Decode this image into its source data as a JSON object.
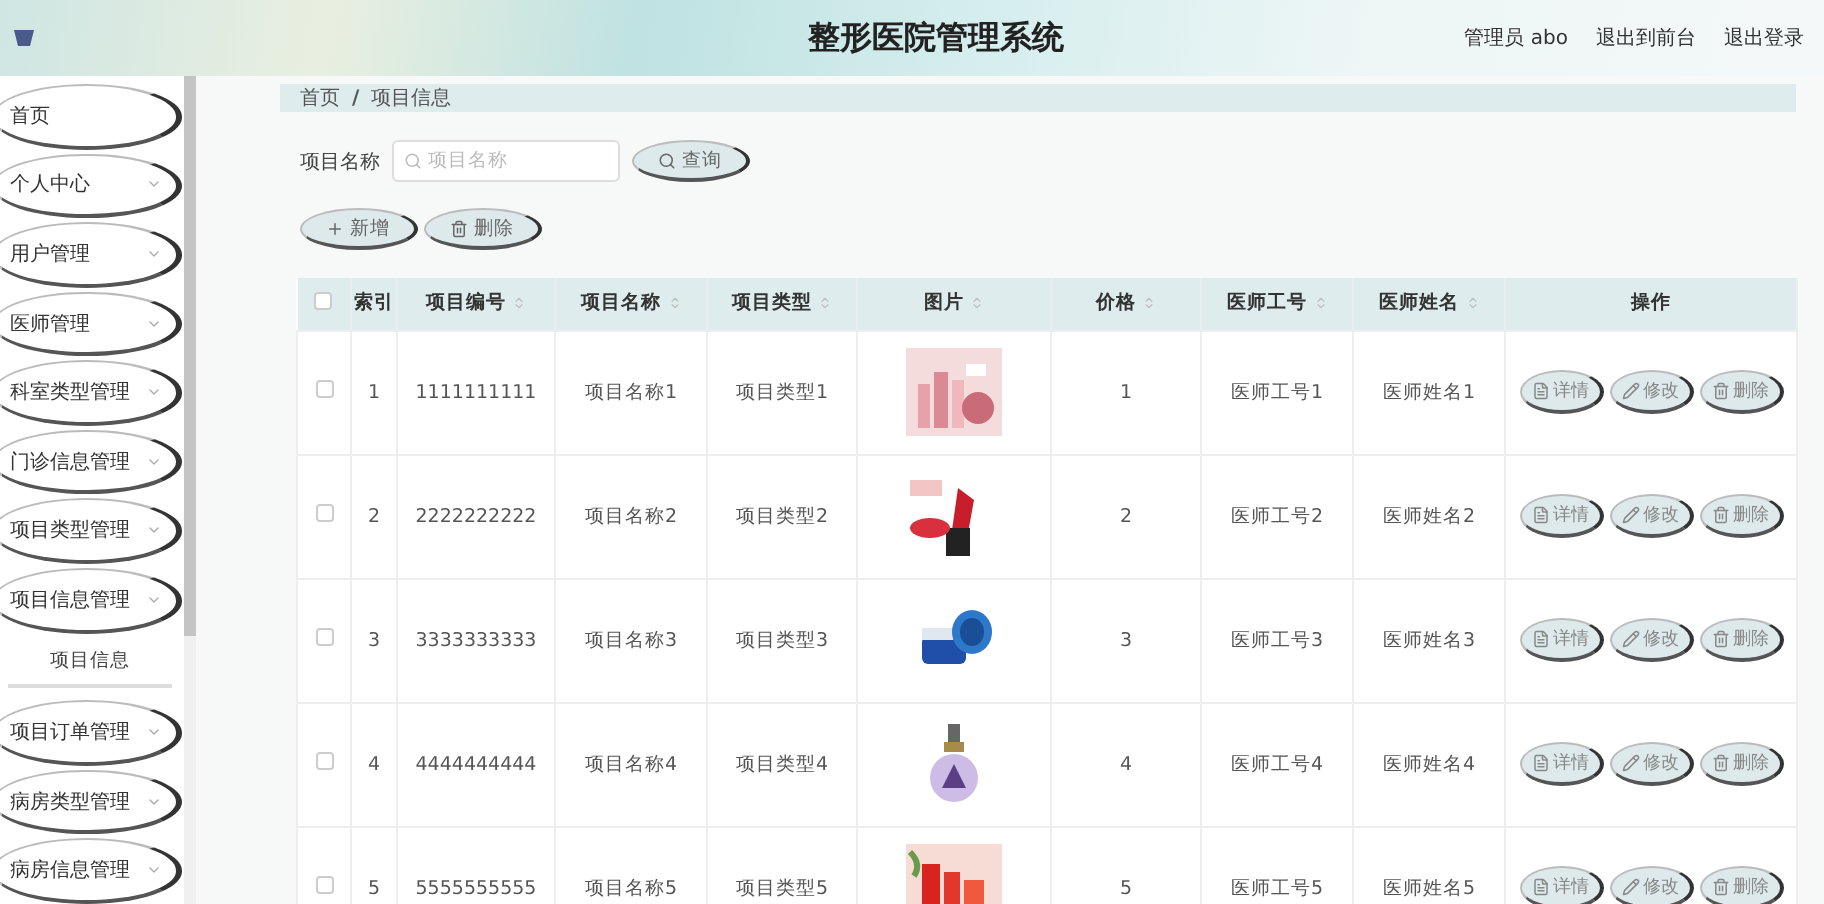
{
  "header": {
    "title": "整形医院管理系统",
    "user": "管理员 abo",
    "links": [
      "退出到前台",
      "退出登录"
    ]
  },
  "sidebar": {
    "items": [
      {
        "label": "首页",
        "has_caret": false
      },
      {
        "label": "个人中心",
        "has_caret": true
      },
      {
        "label": "用户管理",
        "has_caret": true
      },
      {
        "label": "医师管理",
        "has_caret": true
      },
      {
        "label": "科室类型管理",
        "has_caret": true
      },
      {
        "label": "门诊信息管理",
        "has_caret": true
      },
      {
        "label": "项目类型管理",
        "has_caret": true
      },
      {
        "label": "项目信息管理",
        "has_caret": true,
        "children": [
          {
            "label": "项目信息"
          }
        ]
      },
      {
        "label": "项目订单管理",
        "has_caret": true
      },
      {
        "label": "病房类型管理",
        "has_caret": true
      },
      {
        "label": "病房信息管理",
        "has_caret": true
      }
    ]
  },
  "breadcrumb": {
    "items": [
      "首页",
      "项目信息"
    ],
    "separator": "/"
  },
  "search": {
    "label": "项目名称",
    "placeholder": "项目名称",
    "button": "查询"
  },
  "actions": [
    {
      "kind": "add",
      "label": "新增"
    },
    {
      "kind": "delete",
      "label": "删除"
    }
  ],
  "table": {
    "header_checked": false,
    "columns": [
      {
        "label": "索引",
        "kind": "text",
        "sortable": false
      },
      {
        "label": "项目编号",
        "kind": "text",
        "sortable": true
      },
      {
        "label": "项目名称",
        "kind": "text",
        "sortable": true
      },
      {
        "label": "项目类型",
        "kind": "text",
        "sortable": true
      },
      {
        "label": "图片",
        "kind": "picture",
        "sortable": true
      },
      {
        "label": "价格",
        "kind": "text",
        "sortable": true
      },
      {
        "label": "医师工号",
        "kind": "text",
        "sortable": true
      },
      {
        "label": "医师姓名",
        "kind": "text",
        "sortable": true
      },
      {
        "label": "操作",
        "kind": "actions",
        "sortable": false
      }
    ],
    "rows": [
      {
        "checked": false,
        "cells": [
          "1",
          "1111111111",
          "项目名称1",
          "项目类型1",
          "",
          "1",
          "医师工号1",
          "医师姓名1"
        ],
        "actions": [
          {
            "kind": "detail",
            "label": "详情"
          },
          {
            "kind": "edit",
            "label": "修改"
          },
          {
            "kind": "delete",
            "label": "删除"
          }
        ]
      },
      {
        "checked": false,
        "cells": [
          "2",
          "2222222222",
          "项目名称2",
          "项目类型2",
          "",
          "2",
          "医师工号2",
          "医师姓名2"
        ],
        "actions": [
          {
            "kind": "detail",
            "label": "详情"
          },
          {
            "kind": "edit",
            "label": "修改"
          },
          {
            "kind": "delete",
            "label": "删除"
          }
        ]
      },
      {
        "checked": false,
        "cells": [
          "3",
          "3333333333",
          "项目名称3",
          "项目类型3",
          "",
          "3",
          "医师工号3",
          "医师姓名3"
        ],
        "actions": [
          {
            "kind": "detail",
            "label": "详情"
          },
          {
            "kind": "edit",
            "label": "修改"
          },
          {
            "kind": "delete",
            "label": "删除"
          }
        ]
      },
      {
        "checked": false,
        "cells": [
          "4",
          "4444444444",
          "项目名称4",
          "项目类型4",
          "",
          "4",
          "医师工号4",
          "医师姓名4"
        ],
        "actions": [
          {
            "kind": "detail",
            "label": "详情"
          },
          {
            "kind": "edit",
            "label": "修改"
          },
          {
            "kind": "delete",
            "label": "删除"
          }
        ]
      },
      {
        "checked": false,
        "cells": [
          "5",
          "5555555555",
          "项目名称5",
          "项目类型5",
          "",
          "5",
          "医师工号5",
          "医师姓名5"
        ],
        "actions": [
          {
            "kind": "detail",
            "label": "详情"
          },
          {
            "kind": "edit",
            "label": "修改"
          },
          {
            "kind": "delete",
            "label": "删除"
          }
        ]
      }
    ]
  }
}
